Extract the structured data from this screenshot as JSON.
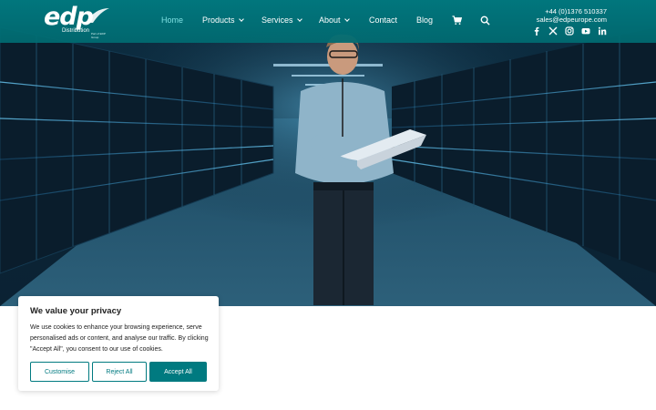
{
  "brand": {
    "logo_text": "edp",
    "logo_sub": "Distribution",
    "logo_tagline": "Part of EDP Group",
    "accent": "#007a80",
    "nav_active": "#7ee0e2"
  },
  "nav": {
    "items": [
      {
        "label": "Home",
        "active": true
      },
      {
        "label": "Products",
        "dropdown": true
      },
      {
        "label": "Services",
        "dropdown": true
      },
      {
        "label": "About",
        "dropdown": true
      },
      {
        "label": "Contact"
      },
      {
        "label": "Blog"
      }
    ],
    "cart_icon": "cart-icon",
    "search_icon": "search-icon"
  },
  "contact": {
    "phone": "+44 (0)1376 510337",
    "email": "sales@edpeurope.com"
  },
  "social": [
    "facebook-icon",
    "x-icon",
    "instagram-icon",
    "youtube-icon",
    "linkedin-icon"
  ],
  "cookie": {
    "title": "We value your privacy",
    "body": "We use cookies to enhance your browsing experience, serve personalised ads or content, and analyse our traffic. By clicking \"Accept All\", you consent to our use of cookies.",
    "customise": "Customise",
    "reject": "Reject All",
    "accept": "Accept All"
  }
}
